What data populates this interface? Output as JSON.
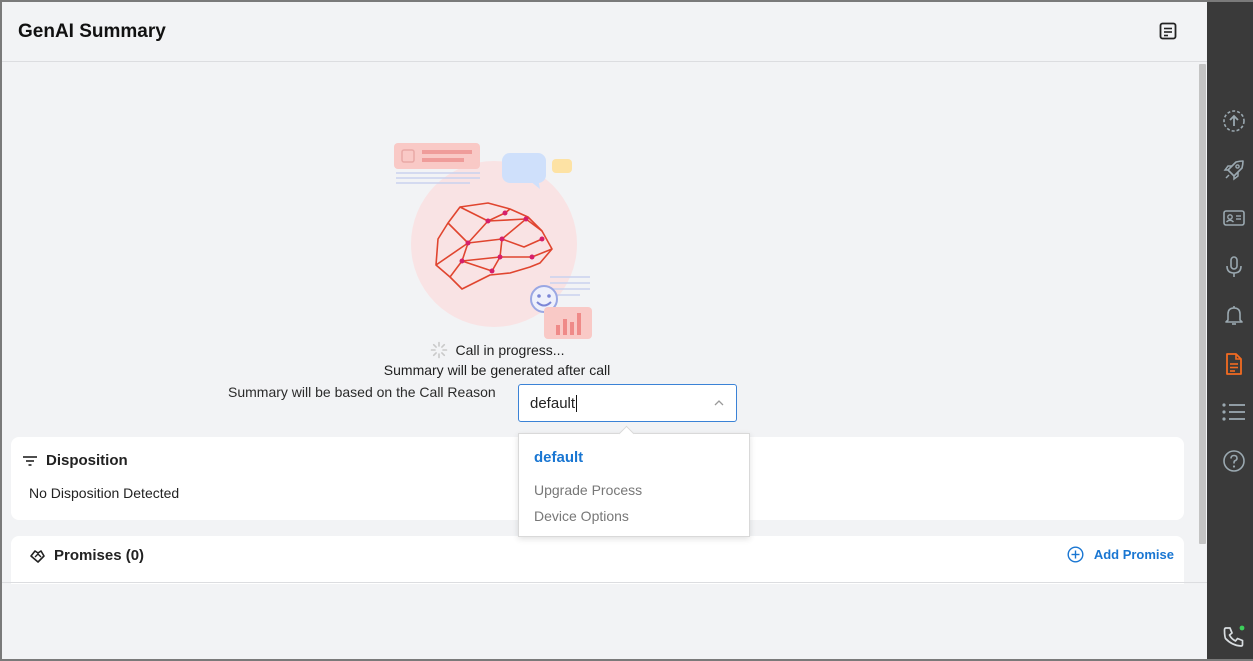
{
  "header": {
    "title": "GenAI Summary",
    "notes_icon": "notes-icon"
  },
  "status": {
    "line1": "Call in progress...",
    "line2": "Summary will be generated after call"
  },
  "call_reason": {
    "label": "Summary will be based on the Call Reason",
    "value": "default"
  },
  "dropdown": {
    "options": [
      "default",
      "Upgrade Process",
      "Device Options"
    ],
    "selected": "default"
  },
  "disposition": {
    "title": "Disposition",
    "text": "No Disposition Detected"
  },
  "promises": {
    "title": "Promises (0)",
    "add_label": "Add Promise"
  },
  "sidebar": {
    "icons": [
      "upload-circle-icon",
      "rocket-icon",
      "contact-card-icon",
      "microphone-icon",
      "bell-icon",
      "document-icon",
      "list-icon",
      "help-icon",
      "phone-icon"
    ],
    "active": "document-icon",
    "accent": "#f26b21"
  },
  "colors": {
    "accent_blue": "#1976d2",
    "sidebar_bg": "#3a3a3a"
  }
}
